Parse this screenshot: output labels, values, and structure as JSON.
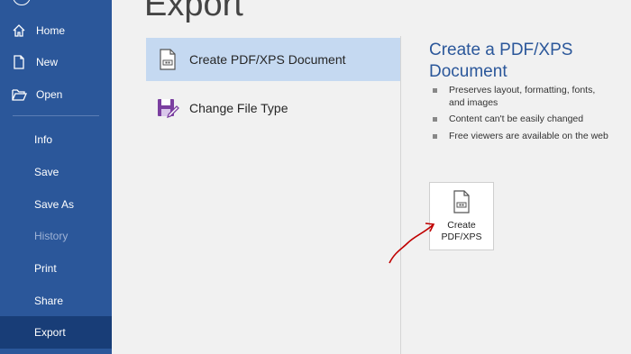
{
  "sidebar": {
    "items": [
      {
        "label": "Home",
        "icon": "home-icon"
      },
      {
        "label": "New",
        "icon": "new-document-icon"
      },
      {
        "label": "Open",
        "icon": "folder-open-icon"
      },
      {
        "label": "Info"
      },
      {
        "label": "Save"
      },
      {
        "label": "Save As"
      },
      {
        "label": "History",
        "disabled": true
      },
      {
        "label": "Print"
      },
      {
        "label": "Share"
      },
      {
        "label": "Export",
        "selected": true
      }
    ]
  },
  "page": {
    "title": "Export"
  },
  "options": [
    {
      "label": "Create PDF/XPS Document",
      "icon": "pdf-document-icon",
      "selected": true
    },
    {
      "label": "Change File Type",
      "icon": "change-file-type-icon"
    }
  ],
  "details": {
    "title": "Create a PDF/XPS Document",
    "bullets": [
      "Preserves layout, formatting, fonts, and images",
      "Content can't be easily changed",
      "Free viewers are available on the web"
    ],
    "button_label": "Create PDF/XPS"
  },
  "colors": {
    "sidebar": "#2b579a",
    "sidebar_selected": "#183d77",
    "option_selected": "#c5d9f1",
    "accent_text": "#2b579a",
    "annotation_arrow": "#c00000"
  }
}
